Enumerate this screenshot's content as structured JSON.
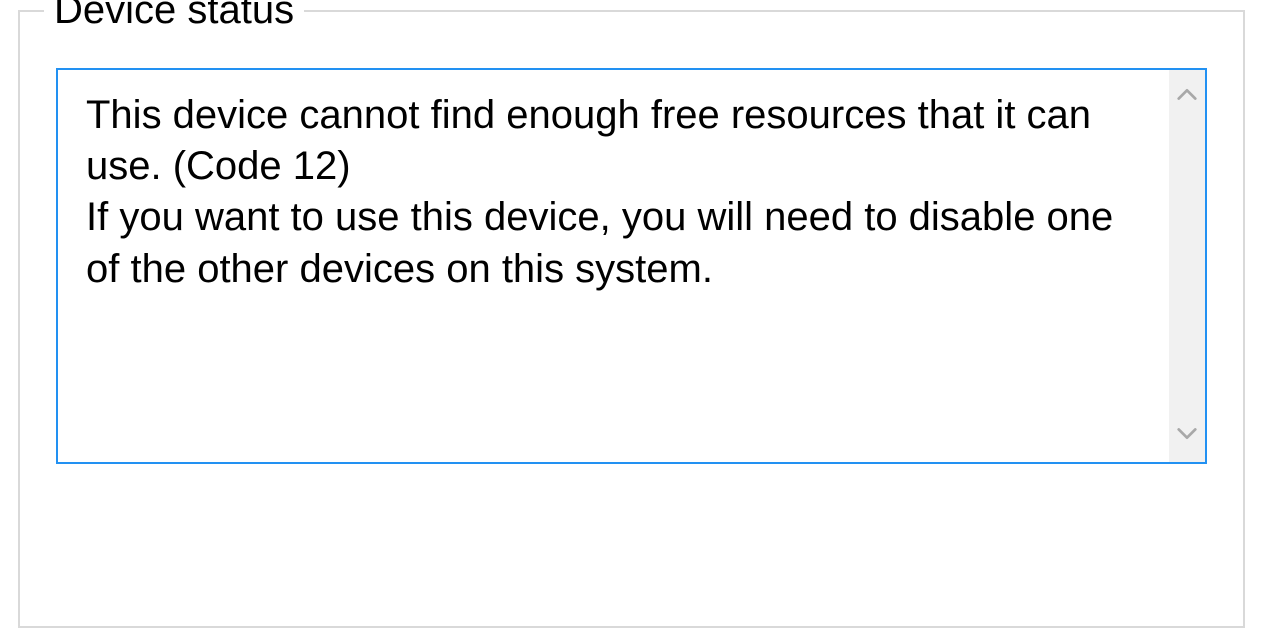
{
  "device_status": {
    "legend": "Device status",
    "message": "This device cannot find enough free resources that it can use. (Code 12)\nIf you want to use this device, you will need to disable one of the other devices on this system."
  }
}
